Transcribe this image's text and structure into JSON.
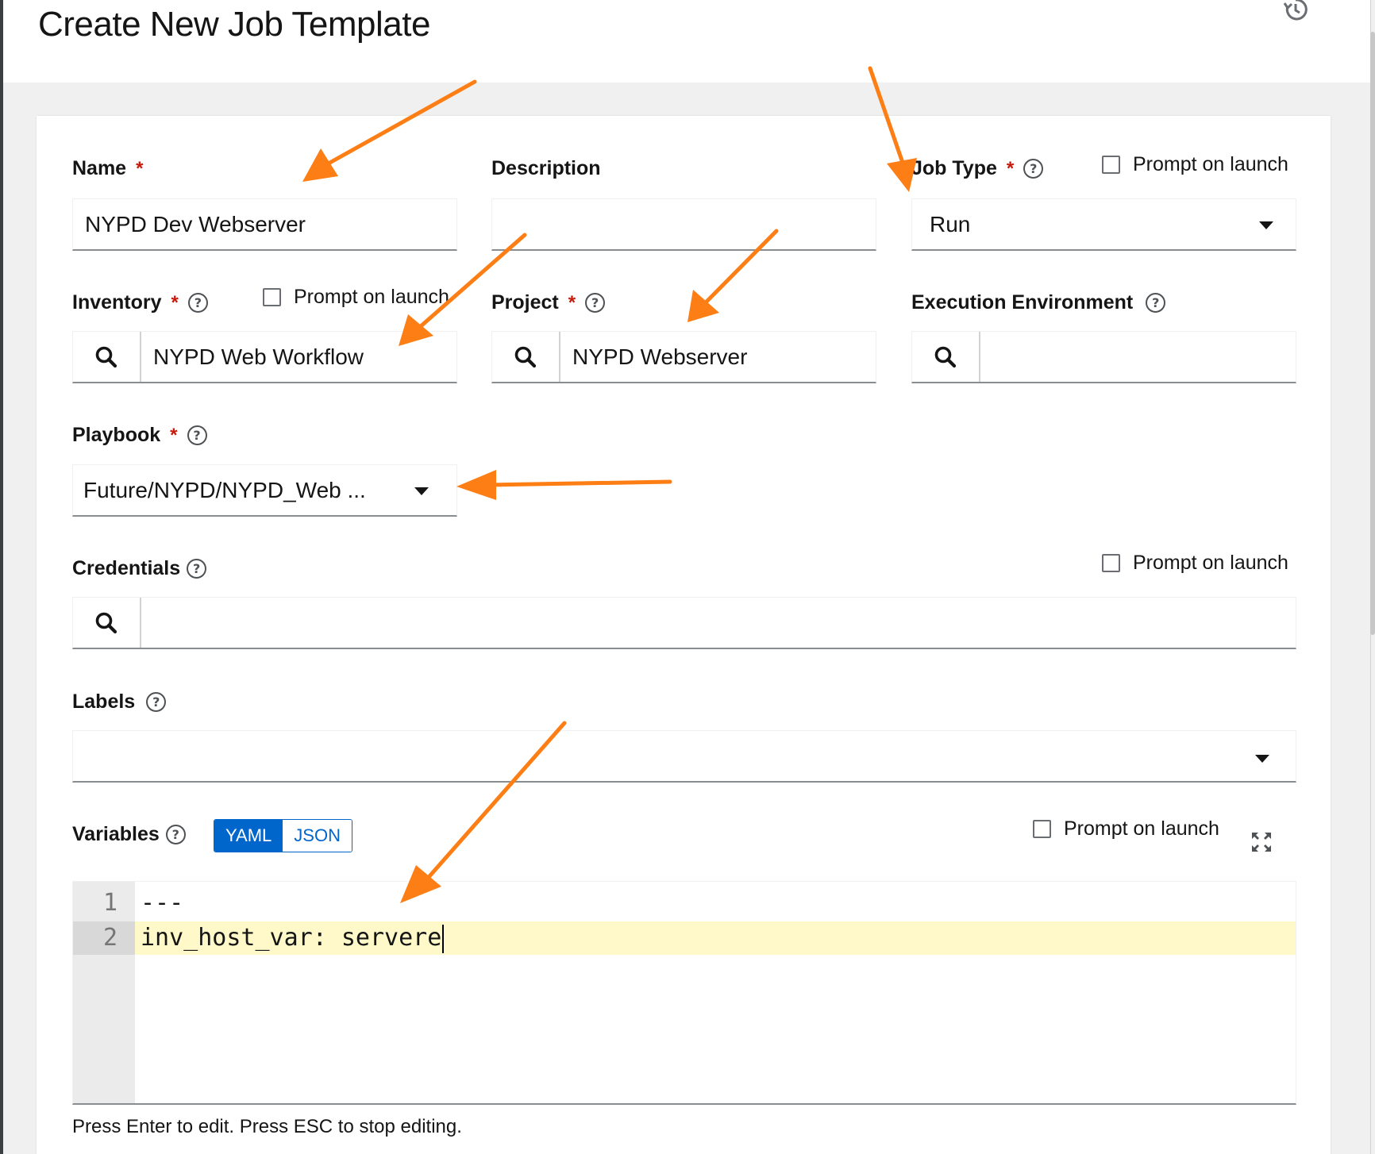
{
  "page": {
    "title": "Create New Job Template"
  },
  "form": {
    "name": {
      "label": "Name",
      "value": "NYPD Dev Webserver"
    },
    "description": {
      "label": "Description",
      "value": ""
    },
    "job_type": {
      "label": "Job Type",
      "value": "Run",
      "prompt_label": "Prompt on launch"
    },
    "inventory": {
      "label": "Inventory",
      "value": "NYPD Web Workflow",
      "prompt_label": "Prompt on launch"
    },
    "project": {
      "label": "Project",
      "value": "NYPD Webserver"
    },
    "execution_environment": {
      "label": "Execution Environment",
      "value": ""
    },
    "playbook": {
      "label": "Playbook",
      "value": "Future/NYPD/NYPD_Web ..."
    },
    "credentials": {
      "label": "Credentials",
      "value": "",
      "prompt_label": "Prompt on launch"
    },
    "labels": {
      "label": "Labels",
      "value": ""
    },
    "variables": {
      "label": "Variables",
      "mode_options": [
        "YAML",
        "JSON"
      ],
      "selected_mode": "YAML",
      "prompt_label": "Prompt on launch",
      "line_numbers": [
        "1",
        "2"
      ],
      "lines": [
        "---",
        "inv_host_var: servere"
      ],
      "hint": "Press Enter to edit. Press ESC to stop editing."
    }
  },
  "required_marker": "*",
  "help_glyph": "?",
  "icons": {
    "history": "history-icon",
    "search": "search-icon",
    "help": "help-icon",
    "caret": "caret-down-icon",
    "expand": "expand-icon"
  },
  "colors": {
    "accent": "#0066cc",
    "required": "#c9190b",
    "annotation_arrow": "#fd7e14",
    "active_line": "#fff9c9"
  }
}
